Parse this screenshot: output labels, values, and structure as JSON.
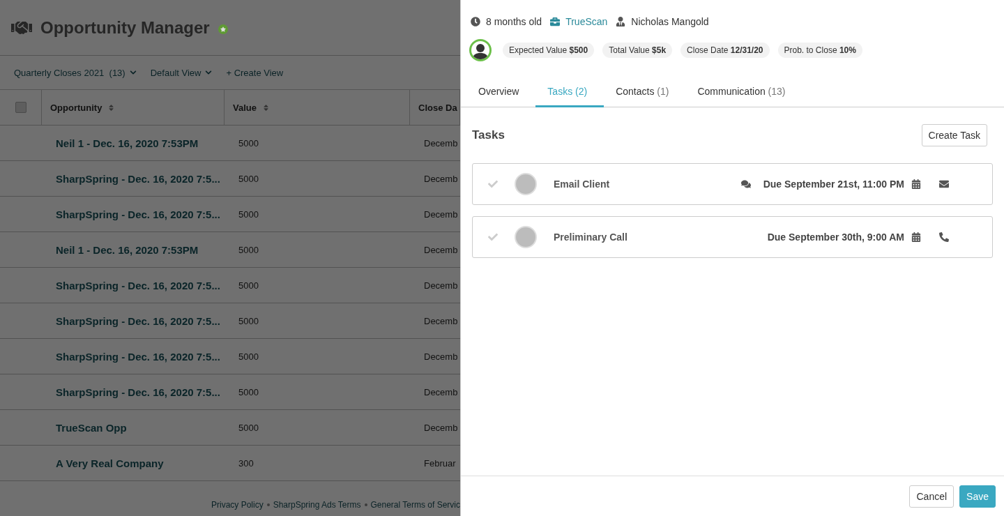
{
  "page": {
    "title": "Opportunity Manager"
  },
  "filters": [
    {
      "label": "Quarterly Closes 2021  (13)",
      "kind": "dropdown"
    },
    {
      "label": "Default View",
      "kind": "dropdown"
    },
    {
      "label": "+ Create View",
      "kind": "link"
    }
  ],
  "table": {
    "select_all": {
      "checked": false
    },
    "columns": [
      {
        "label": "Opportunity",
        "sortable": true
      },
      {
        "label": "Value",
        "sortable": true
      },
      {
        "label": "Close Da",
        "sortable": false
      }
    ],
    "rows": [
      {
        "name": "Neil 1 - Dec. 16, 2020 7:53PM",
        "value": "5000",
        "close": "Decemb"
      },
      {
        "name": "SharpSpring - Dec. 16, 2020 7:5...",
        "value": "5000",
        "close": "Decemb"
      },
      {
        "name": "SharpSpring - Dec. 16, 2020 7:5...",
        "value": "5000",
        "close": "Decemb"
      },
      {
        "name": "Neil 1 - Dec. 16, 2020 7:53PM",
        "value": "5000",
        "close": "Decemb"
      },
      {
        "name": "SharpSpring - Dec. 16, 2020 7:5...",
        "value": "5000",
        "close": "Decemb"
      },
      {
        "name": "SharpSpring - Dec. 16, 2020 7:5...",
        "value": "5000",
        "close": "Decemb"
      },
      {
        "name": "SharpSpring - Dec. 16, 2020 7:5...",
        "value": "5000",
        "close": "Decemb"
      },
      {
        "name": "SharpSpring - Dec. 16, 2020 7:5...",
        "value": "5000",
        "close": "Decemb"
      },
      {
        "name": "TrueScan Opp",
        "value": "5000",
        "close": "Decemb"
      },
      {
        "name": "A Very Real Company",
        "value": "300",
        "close": "Februar"
      }
    ]
  },
  "footer": {
    "links": [
      "Privacy Policy",
      "SharpSpring Ads Terms",
      "General Terms of Servic"
    ]
  },
  "panel": {
    "age": "8 months old",
    "company": "TrueScan",
    "owner": "Nicholas Mangold",
    "chips": [
      {
        "label": "Expected Value",
        "value": "$500"
      },
      {
        "label": "Total Value",
        "value": "$5k"
      },
      {
        "label": "Close Date",
        "value": "12/31/20"
      },
      {
        "label": "Prob. to Close",
        "value": "10%"
      }
    ],
    "tabs": [
      {
        "label": "Overview",
        "selected": false
      },
      {
        "label": "Tasks",
        "count": "(2)",
        "selected": true
      },
      {
        "label": "Contacts",
        "count": "(1)",
        "selected": false
      },
      {
        "label": "Communication",
        "count": "(13)",
        "selected": false
      }
    ],
    "section_title": "Tasks",
    "create_button": "Create Task",
    "tasks": [
      {
        "title": "Email Client",
        "due": "Due September 21st, 11:00 PM",
        "done": false,
        "has_comments": true,
        "kind": "email"
      },
      {
        "title": "Preliminary Call",
        "due": "Due September 30th, 9:00 AM",
        "done": false,
        "has_comments": false,
        "kind": "call"
      }
    ],
    "buttons": [
      {
        "label": "Cancel",
        "kind": "secondary"
      },
      {
        "label": "Save",
        "kind": "primary"
      }
    ]
  }
}
